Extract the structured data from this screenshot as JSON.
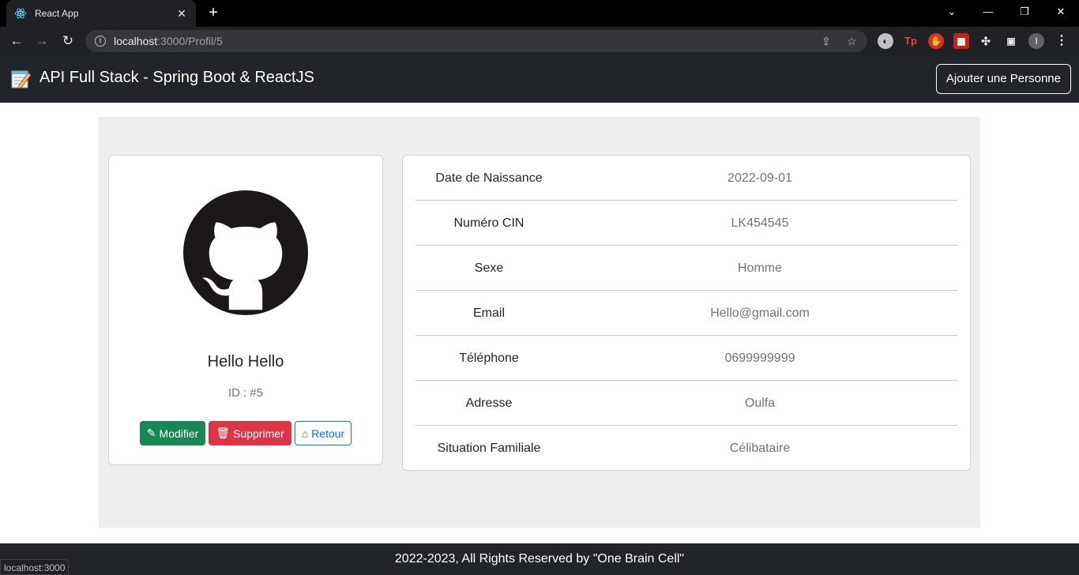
{
  "browser": {
    "tab_title": "React App",
    "url_host": "localhost",
    "url_path": ":3000/Profil/5",
    "status_url": "localhost:3000",
    "profile_initial": "I"
  },
  "navbar": {
    "brand": "API Full Stack - Spring Boot & ReactJS",
    "add_button": "Ajouter une Personne"
  },
  "profile": {
    "name": "Hello Hello",
    "id_text": "ID : #5",
    "buttons": {
      "edit": "Modifier",
      "delete": "Supprimer",
      "back": "Retour"
    }
  },
  "details": [
    {
      "label": "Date de Naissance",
      "value": "2022-09-01"
    },
    {
      "label": "Numéro CIN",
      "value": "LK454545"
    },
    {
      "label": "Sexe",
      "value": "Homme"
    },
    {
      "label": "Email",
      "value": "Hello@gmail.com"
    },
    {
      "label": "Téléphone",
      "value": "0699999999"
    },
    {
      "label": "Adresse",
      "value": "Oulfa"
    },
    {
      "label": "Situation Familiale",
      "value": "Célibataire"
    }
  ],
  "footer": {
    "text": "2022-2023, All Rights Reserved by \"One Brain Cell\""
  },
  "colors": {
    "navbar_bg": "#212529",
    "success": "#198754",
    "danger": "#dc3545",
    "primary": "#0d6efd",
    "page_bg": "#eeeeee"
  }
}
